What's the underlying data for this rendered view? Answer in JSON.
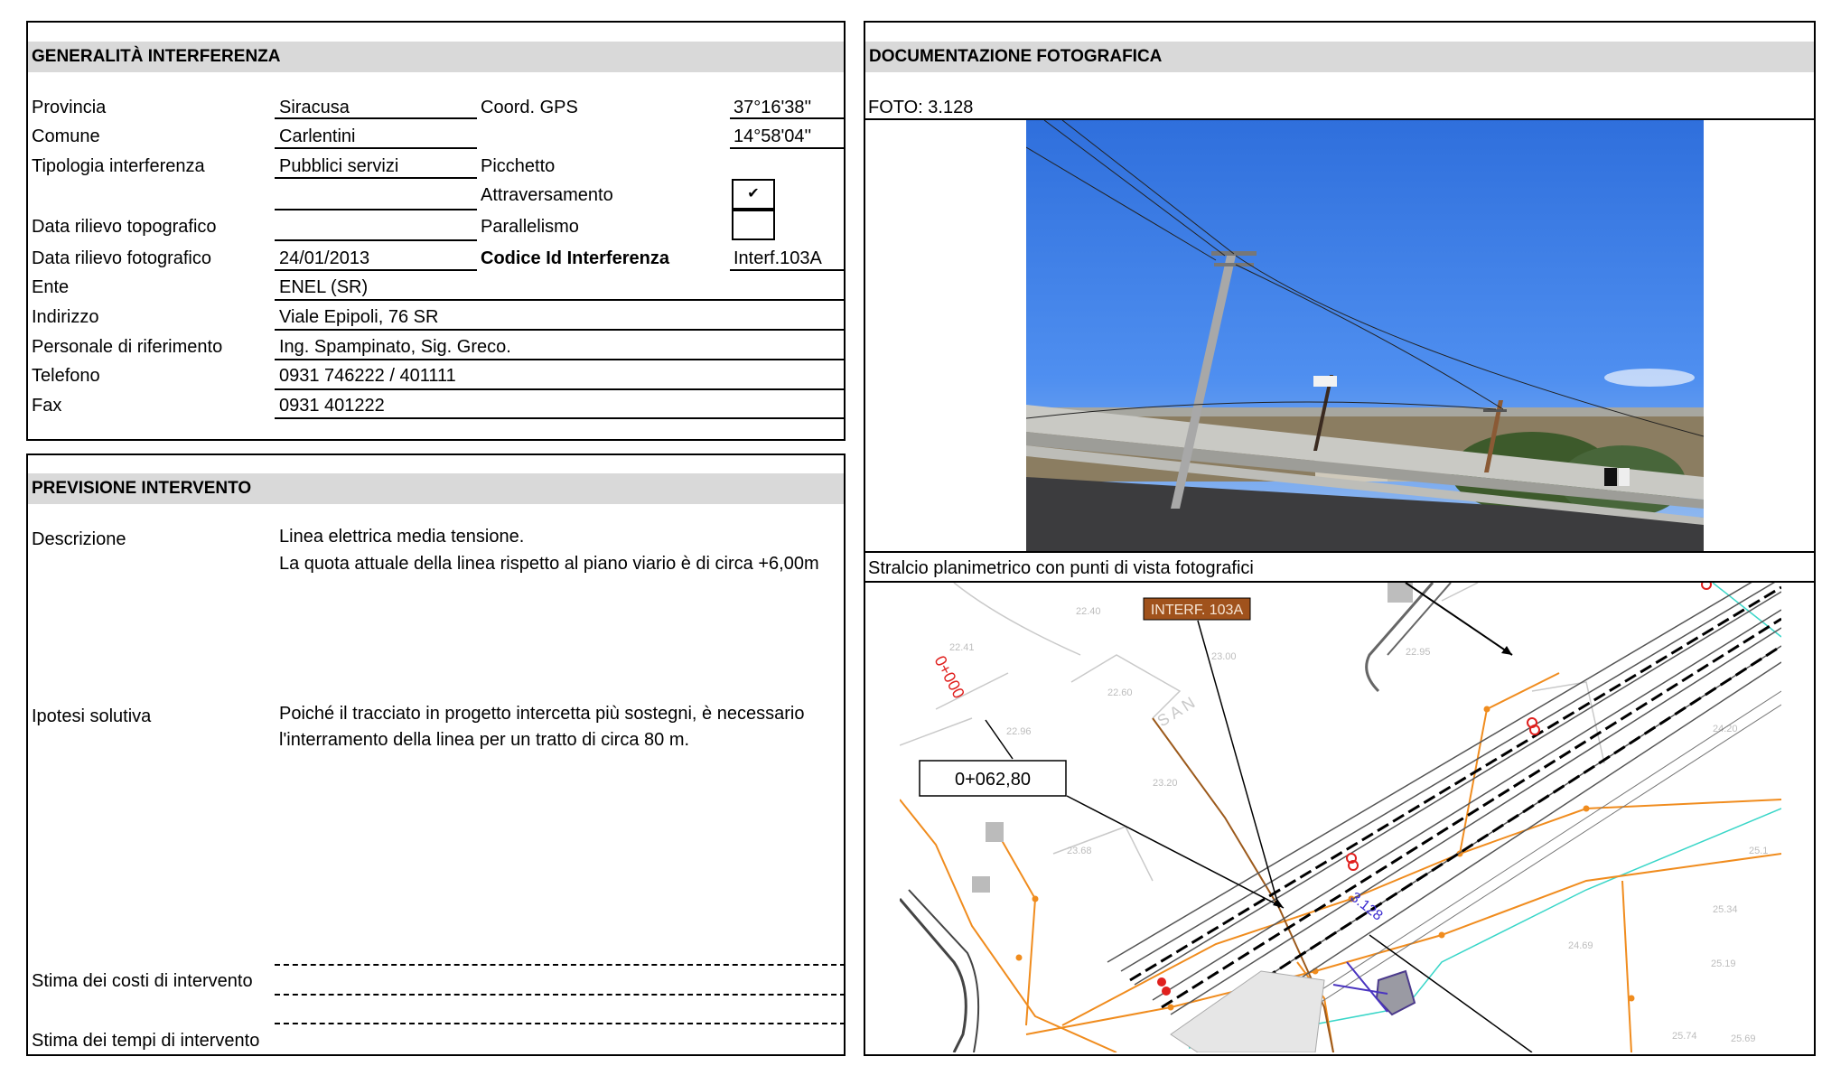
{
  "generalita": {
    "header": "GENERALITÀ  INTERFERENZA",
    "provincia_label": "Provincia",
    "provincia": "Siracusa",
    "coord_label": "Coord. GPS",
    "lat": "37°16'38''",
    "comune_label": "Comune",
    "comune": "Carlentini",
    "lon": "14°58'04''",
    "tipologia_label": "Tipologia interferenza",
    "tipologia": "Pubblici servizi",
    "picchetto_label": "Picchetto",
    "attraversamento_label": "Attraversamento",
    "attraversamento_check": "✔",
    "topografico_label": "Data rilievo topografico",
    "parallelismo_label": "Parallelismo",
    "fotografico_label": "Data rilievo fotografico",
    "fotografico": "24/01/2013",
    "codice_label": "Codice Id Interferenza",
    "codice": "Interf.103A",
    "ente_label": "Ente",
    "ente": "ENEL (SR)",
    "indirizzo_label": "Indirizzo",
    "indirizzo": "Viale Epipoli, 76 SR",
    "personale_label": "Personale di riferimento",
    "personale": "Ing. Spampinato, Sig. Greco.",
    "telefono_label": "Telefono",
    "telefono": "0931 746222 / 401111",
    "fax_label": "Fax",
    "fax": "0931 401222"
  },
  "previsione": {
    "header": "PREVISIONE INTERVENTO",
    "descrizione_label": "Descrizione",
    "descrizione_1": "Linea elettrica media tensione.",
    "descrizione_2": "La quota attuale della linea rispetto al piano viario è di circa +6,00m",
    "ipotesi_label": "Ipotesi solutiva",
    "ipotesi_1": "Poiché il tracciato in progetto intercetta più sostegni, è necessario",
    "ipotesi_2": "l'interramento della linea per un tratto di circa 80 m.",
    "costi_label": "Stima dei costi di intervento",
    "tempi_label": "Stima dei tempi di intervento"
  },
  "documentazione": {
    "header": "DOCUMENTAZIONE FOTOGRAFICA",
    "foto_label": "FOTO: 3.128",
    "stralcio_label": "Stralcio planimetrico con punti di vista fotografici"
  },
  "map": {
    "interf_label": "INTERF. 103A",
    "chainage_start": "0+000",
    "chainage_box": "0+062,80",
    "photo_point": "3.128",
    "elev_1": "22.40",
    "elev_2": "22.41",
    "elev_3": "23.00",
    "elev_4": "22.95",
    "elev_5": "22.60",
    "elev_6": "22.96",
    "elev_7": "23.20",
    "elev_8": "23.68",
    "elev_9": "25.34",
    "elev_10": "24.69",
    "elev_11": "25.19",
    "elev_12": "25.74",
    "elev_13": "25.69",
    "elev_14": "24.20",
    "elev_15": "25.1"
  }
}
